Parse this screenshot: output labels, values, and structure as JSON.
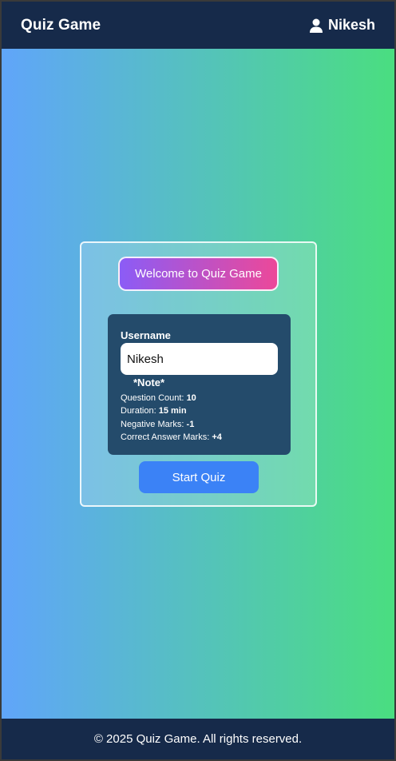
{
  "navbar": {
    "brand": "Quiz Game",
    "user_icon": "user-icon",
    "username": "Nikesh"
  },
  "card": {
    "welcome": "Welcome to Quiz Game",
    "username_label": "Username",
    "username_value": "Nikesh",
    "note_title": "*Note*",
    "info": [
      {
        "label": "Question Count: ",
        "value": "10"
      },
      {
        "label": "Duration: ",
        "value": "15 min"
      },
      {
        "label": "Negative Marks: ",
        "value": "-1"
      },
      {
        "label": "Correct Answer Marks: ",
        "value": "+4"
      }
    ],
    "start_button": "Start Quiz"
  },
  "footer": {
    "text": "© 2025 Quiz Game. All rights reserved."
  },
  "colors": {
    "navbar": "#162a4a",
    "gradient_start": "#60a5fa",
    "gradient_end": "#4ade80",
    "welcome_start": "#8b5cf6",
    "welcome_end": "#ec4899",
    "panel": "#244b6b",
    "button": "#3b82f6"
  }
}
